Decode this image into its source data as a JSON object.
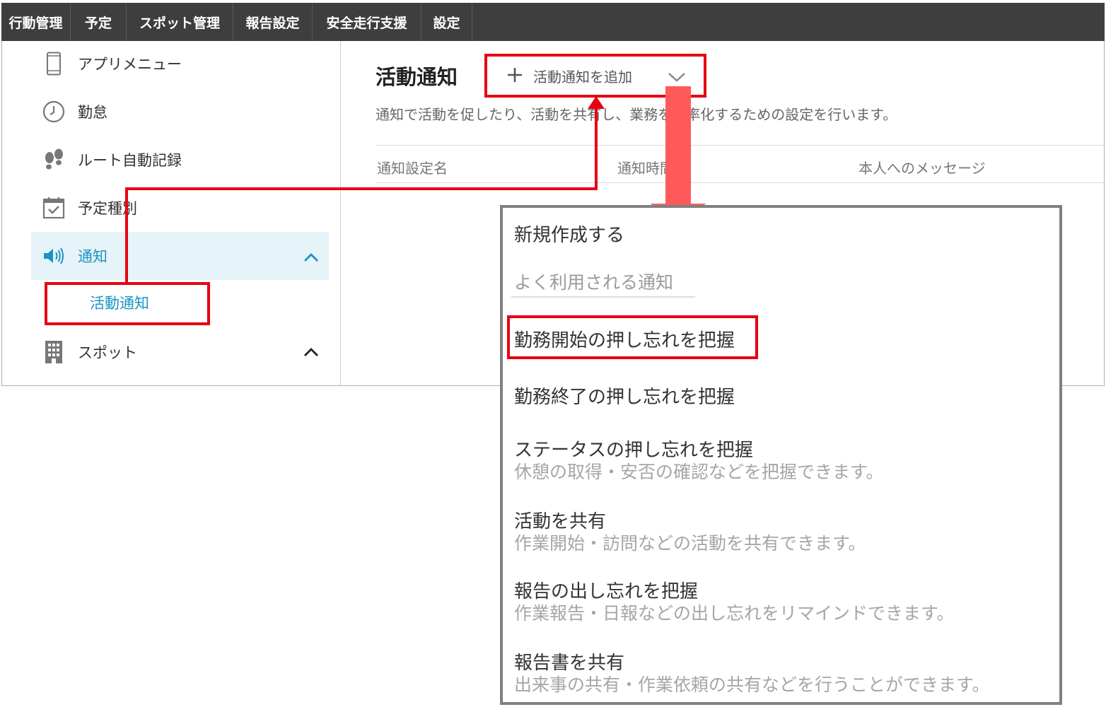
{
  "topnav": {
    "items": [
      {
        "label": "行動管理"
      },
      {
        "label": "予定"
      },
      {
        "label": "スポット管理"
      },
      {
        "label": "報告設定"
      },
      {
        "label": "安全走行支援"
      },
      {
        "label": "設定"
      }
    ]
  },
  "sidebar": {
    "items": [
      {
        "label": "アプリメニュー",
        "icon": "smartphone-icon"
      },
      {
        "label": "勤怠",
        "icon": "clock-icon"
      },
      {
        "label": "ルート自動記録",
        "icon": "footprints-icon"
      },
      {
        "label": "予定種別",
        "icon": "calendar-check-icon"
      },
      {
        "label": "通知",
        "icon": "speaker-icon",
        "active": true,
        "expanded": true
      },
      {
        "label": "スポット",
        "icon": "building-icon",
        "expanded": true
      }
    ],
    "sub_items": [
      {
        "label": "活動通知"
      }
    ]
  },
  "main": {
    "title": "活動通知",
    "add_button": {
      "label": "活動通知を追加"
    },
    "description": "通知で活動を促したり、活動を共有し、業務を効率化するための設定を行います。",
    "table": {
      "columns": [
        "通知設定名",
        "通知時間",
        "本人へのメッセージ"
      ]
    }
  },
  "dropdown": {
    "create_new": "新規作成する",
    "section_header": "よく利用される通知",
    "options": [
      {
        "title": "勤務開始の押し忘れを把握",
        "description": ""
      },
      {
        "title": "勤務終了の押し忘れを把握",
        "description": ""
      },
      {
        "title": "ステータスの押し忘れを把握",
        "description": "休憩の取得・安否の確認などを把握できます。"
      },
      {
        "title": "活動を共有",
        "description": "作業開始・訪問などの活動を共有できます。"
      },
      {
        "title": "報告の出し忘れを把握",
        "description": "作業報告・日報などの出し忘れをリマインドできます。"
      },
      {
        "title": "報告書を共有",
        "description": "出来事の共有・作業依頼の共有などを行うことができます。"
      }
    ]
  },
  "colors": {
    "topnav_bg": "#3e3e3e",
    "accent_blue": "#1a94c3",
    "active_bg": "#e6f3f9",
    "highlight_red": "#e60012",
    "arrow_red": "#ff5a5a"
  }
}
